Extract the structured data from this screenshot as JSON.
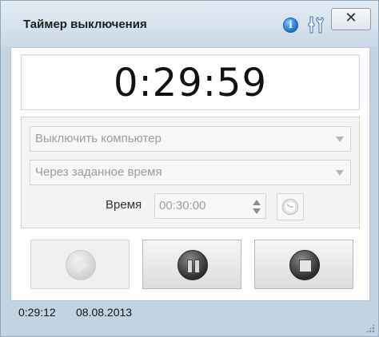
{
  "window": {
    "title": "Таймер выключения",
    "info_symbol": "i",
    "close_symbol": "✕"
  },
  "timer": {
    "display": "0:29:59"
  },
  "settings": {
    "action_select": "Выключить компьютер",
    "mode_select": "Через заданное время",
    "time_label": "Время",
    "time_value": "00:30:00"
  },
  "controls": {
    "play": "play-icon",
    "pause": "pause-icon",
    "stop": "stop-icon"
  },
  "status": {
    "time": "0:29:12",
    "date": "08.08.2013"
  },
  "colors": {
    "window_bg": "#c2d3e2",
    "accent_info": "#1f6fcc"
  }
}
